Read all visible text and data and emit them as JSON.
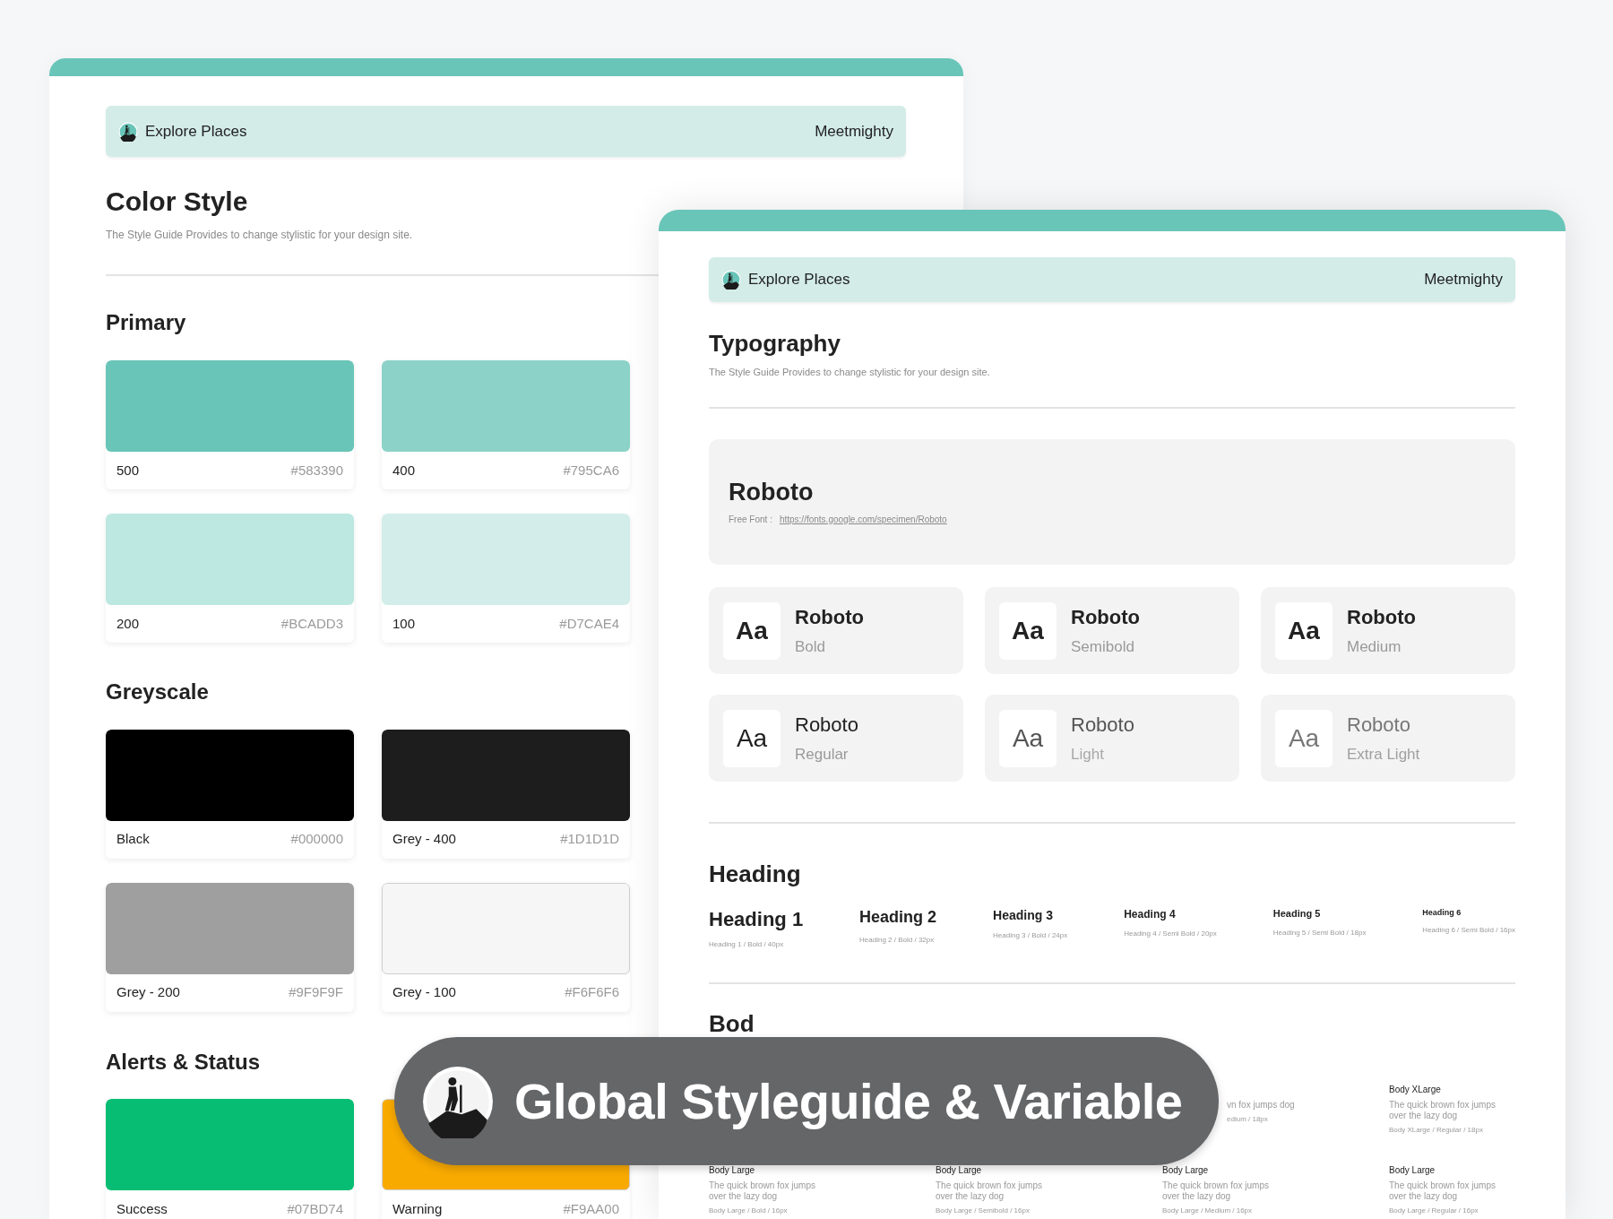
{
  "color_window": {
    "header": {
      "title": "Explore Places",
      "brand": "Meetmighty"
    },
    "title": "Color Style",
    "subtitle": "The Style Guide Provides to change stylistic for your design site.",
    "groups": [
      {
        "title": "Primary",
        "swatches": [
          {
            "name": "500",
            "hex": "#583390",
            "color": "#69c5b8"
          },
          {
            "name": "400",
            "hex": "#795CA6",
            "color": "#8dd2c8"
          },
          {
            "name": "200",
            "hex": "#BCADD3",
            "color": "#bce8e1"
          },
          {
            "name": "100",
            "hex": "#D7CAE4",
            "color": "#d3eeea"
          }
        ]
      },
      {
        "title": "Greyscale",
        "swatches": [
          {
            "name": "Black",
            "hex": "#000000",
            "color": "#000000"
          },
          {
            "name": "Grey - 400",
            "hex": "#1D1D1D",
            "color": "#1d1d1d"
          },
          {
            "name": "Grey - 200",
            "hex": "#9F9F9F",
            "color": "#9f9f9f"
          },
          {
            "name": "Grey - 100",
            "hex": "#F6F6F6",
            "color": "#f6f6f6"
          }
        ]
      },
      {
        "title": "Alerts & Status",
        "swatches": [
          {
            "name": "Success",
            "hex": "#07BD74",
            "color": "#07bd74"
          },
          {
            "name": "Warning",
            "hex": "#F9AA00",
            "color": "#f9aa00"
          }
        ]
      }
    ]
  },
  "typography_window": {
    "header": {
      "title": "Explore Places",
      "brand": "Meetmighty"
    },
    "title": "Typography",
    "subtitle": "The Style Guide Provides to change stylistic for your design site.",
    "font": {
      "name": "Roboto",
      "label": "Free Font :",
      "link": "https://fonts.google.com/specimen/Roboto"
    },
    "weights": [
      {
        "sample": "Aa",
        "name": "Roboto",
        "style": "Bold",
        "kind": "bold"
      },
      {
        "sample": "Aa",
        "name": "Roboto",
        "style": "Semibold",
        "kind": "semibold"
      },
      {
        "sample": "Aa",
        "name": "Roboto",
        "style": "Medium",
        "kind": "medium"
      },
      {
        "sample": "Aa",
        "name": "Roboto",
        "style": "Regular",
        "kind": "regular"
      },
      {
        "sample": "Aa",
        "name": "Roboto",
        "style": "Light",
        "kind": "light"
      },
      {
        "sample": "Aa",
        "name": "Roboto",
        "style": "Extra Light",
        "kind": "extralight"
      }
    ],
    "heading_title": "Heading",
    "headings": [
      {
        "text": "Heading 1",
        "spec": "Heading 1 / Bold / 40px",
        "kind": "h1"
      },
      {
        "text": "Heading 2",
        "spec": "Heading 2 / Bold / 32px",
        "kind": "h2"
      },
      {
        "text": "Heading 3",
        "spec": "Heading 3 / Bold / 24px",
        "kind": "h3"
      },
      {
        "text": "Heading 4",
        "spec": "Heading 4 / Semi Bold / 20px",
        "kind": "h4"
      },
      {
        "text": "Heading 5",
        "spec": "Heading 5 / Semi Bold / 18px",
        "kind": "h5"
      },
      {
        "text": "Heading 6",
        "spec": "Heading 6 / Semi Bold / 16px",
        "kind": "h6"
      }
    ],
    "body_title": "Bod",
    "body_partial": {
      "sample": "vn fox jumps dog",
      "spec": "edium / 18px"
    },
    "body_xlarge": {
      "name": "Body XLarge",
      "sample": "The quick brown fox jumps over the lazy dog",
      "spec": "Body XLarge / Regular / 18px"
    },
    "body_large": [
      {
        "name": "Body Large",
        "sample": "The quick brown fox jumps over the lazy dog",
        "spec": "Body Large / Bold / 16px"
      },
      {
        "name": "Body Large",
        "sample": "The quick brown fox jumps over the lazy dog",
        "spec": "Body Large / Semibold / 16px"
      },
      {
        "name": "Body Large",
        "sample": "The quick brown fox jumps over the lazy dog",
        "spec": "Body Large / Medium / 16px"
      },
      {
        "name": "Body Large",
        "sample": "The quick brown fox jumps over the lazy dog",
        "spec": "Body Large / Regular / 16px"
      }
    ]
  },
  "banner": {
    "title": "Global Styleguide & Variable"
  }
}
